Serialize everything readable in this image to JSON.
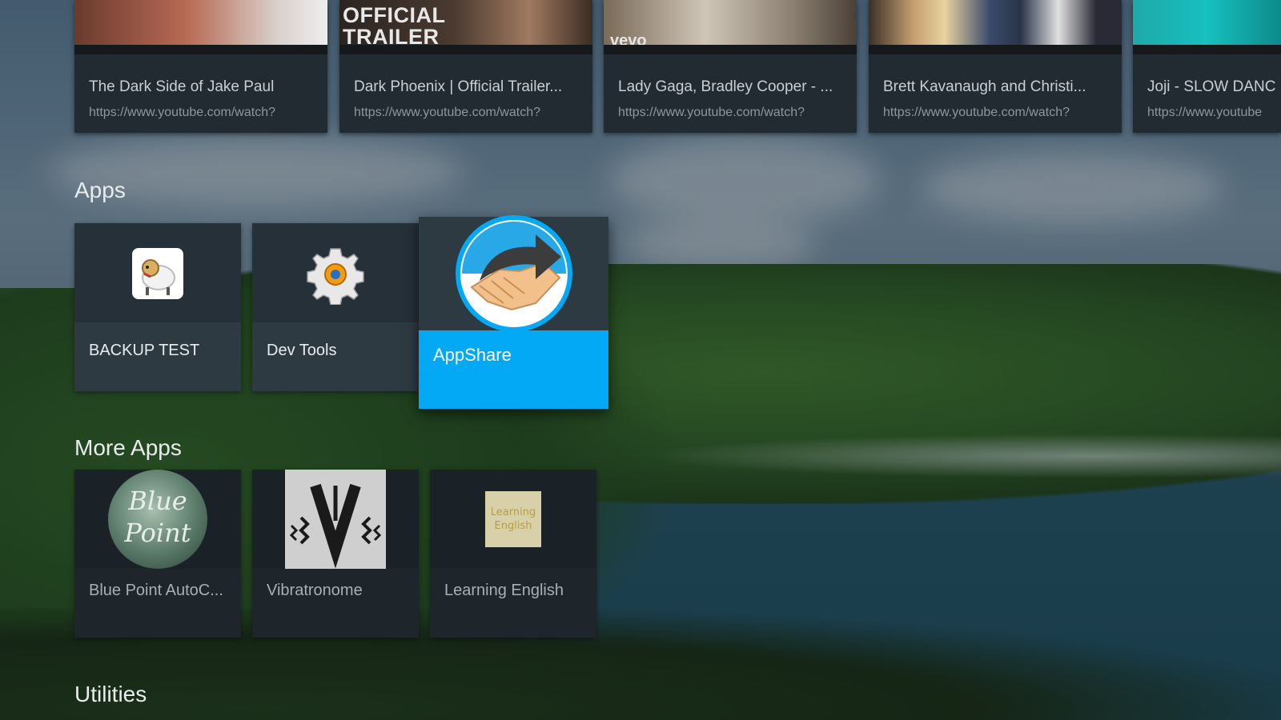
{
  "videos": [
    {
      "title": "The Dark Side of Jake Paul",
      "url": "https://www.youtube.com/watch?",
      "thumb_text": ""
    },
    {
      "title": "Dark Phoenix | Official Trailer...",
      "url": "https://www.youtube.com/watch?",
      "thumb_text": "OFFICIAL TRAILER"
    },
    {
      "title": "Lady Gaga, Bradley Cooper - ...",
      "url": "https://www.youtube.com/watch?",
      "thumb_text": "vevo"
    },
    {
      "title": "Brett Kavanaugh and Christi...",
      "url": "https://www.youtube.com/watch?",
      "thumb_text": ""
    },
    {
      "title": "Joji - SLOW DANC",
      "url": "https://www.youtube",
      "thumb_text": ""
    }
  ],
  "sections": {
    "apps": "Apps",
    "more_apps": "More Apps",
    "utilities": "Utilities"
  },
  "apps": [
    {
      "label": "BACKUP TEST",
      "icon": "sheep-icon"
    },
    {
      "label": "Dev Tools",
      "icon": "gear-icon"
    },
    {
      "label": "AppShare",
      "icon": "share-handshake-icon"
    }
  ],
  "more_apps": [
    {
      "label": "Blue Point AutoC...",
      "icon": "blue-point-logo",
      "logo_line1": "Blue",
      "logo_line2": "Point"
    },
    {
      "label": "Vibratronome",
      "icon": "vibratronome-icon"
    },
    {
      "label": "Learning English",
      "icon": "learning-english-icon",
      "logo_line1": "Learning",
      "logo_line2": "English"
    }
  ],
  "colors": {
    "focus_accent": "#03a9f4",
    "card_bg": "#2e3a42"
  }
}
